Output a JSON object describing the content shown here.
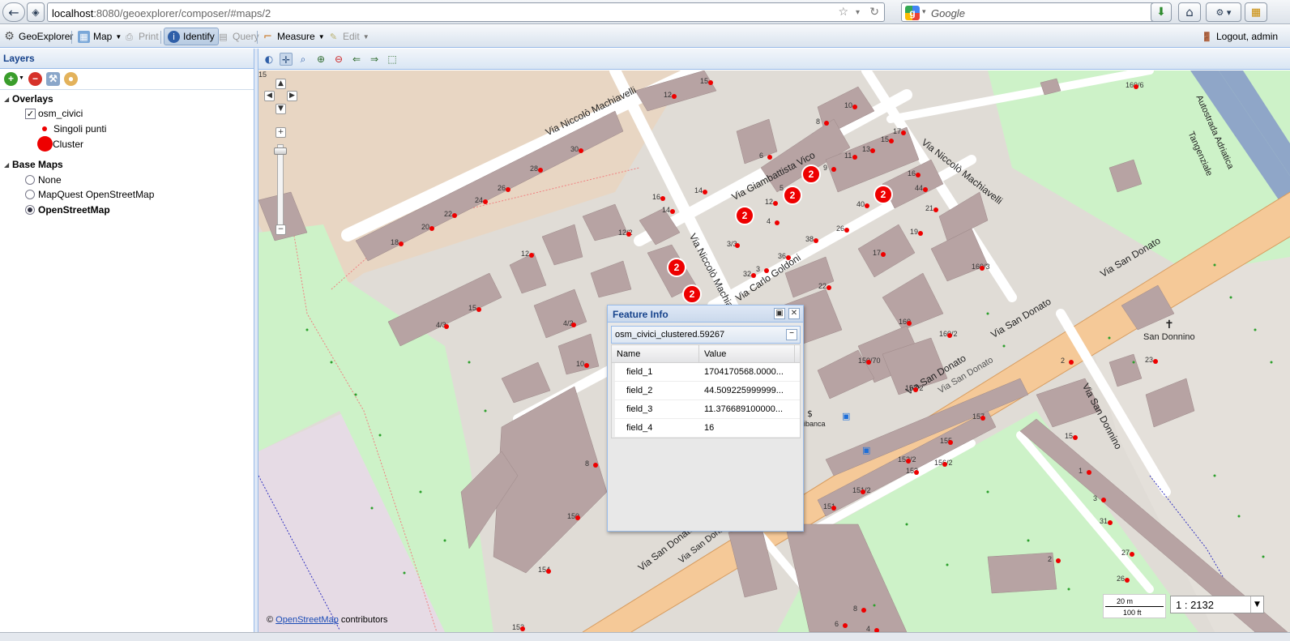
{
  "browser": {
    "url_host": "localhost",
    "url_path": ":8080/geoexplorer/composer/#maps/2",
    "search_placeholder": "Google"
  },
  "app_toolbar": {
    "brand": "GeoExplorer",
    "map": "Map",
    "print": "Print",
    "identify": "Identify",
    "query": "Query",
    "measure": "Measure",
    "edit": "Edit",
    "logout": "Logout, admin"
  },
  "layers_panel": {
    "title": "Layers",
    "overlays_label": "Overlays",
    "overlay_layer": "osm_civici",
    "legend_points": "Singoli punti",
    "legend_cluster": "Cluster",
    "basemaps_label": "Base Maps",
    "basemaps": [
      "None",
      "MapQuest OpenStreetMap",
      "OpenStreetMap"
    ],
    "selected_basemap": "OpenStreetMap"
  },
  "map": {
    "streets": [
      "Via Niccolò Machiavelli",
      "Via Giambattista Vico",
      "Via Niccolò Machiavelli",
      "Via Niccolò Machiave",
      "Via Carlo Goldoni",
      "Via San Donato",
      "Via San Donato",
      "Via San Donato",
      "Via San Donato",
      "Via San Donato",
      "Via San Donnino",
      "Autostrada Adriatica",
      "Tangenziale",
      "Via San Donato"
    ],
    "places": [
      "San Donnino",
      "nibanca"
    ],
    "numbers": [
      "15",
      "12",
      "10",
      "8",
      "6",
      "17",
      "11",
      "13",
      "15",
      "9",
      "5",
      "16",
      "44",
      "40",
      "21",
      "19",
      "17",
      "160/3",
      "160/6",
      "160",
      "160/2",
      "150/70",
      "157/2",
      "157",
      "155",
      "156/2",
      "153",
      "151/2",
      "151",
      "152/2",
      "30",
      "28",
      "26",
      "24",
      "22",
      "20",
      "18",
      "16",
      "14",
      "12/2",
      "12",
      "14",
      "3/3",
      "3",
      "4",
      "12",
      "26",
      "38",
      "36",
      "32",
      "22",
      "15",
      "4/3",
      "4/2",
      "10",
      "8",
      "150",
      "154",
      "152",
      "15",
      "1",
      "3",
      "31",
      "27",
      "26",
      "23",
      "2",
      "8",
      "6",
      "4",
      "2",
      "15"
    ],
    "cluster_count": "2",
    "attribution_prefix": "©",
    "attribution_link": "OpenStreetMap",
    "attribution_suffix": "contributors",
    "scale_m": "20 m",
    "scale_ft": "100 ft",
    "scale_ratio": "1 : 2132"
  },
  "feature_info": {
    "title": "Feature Info",
    "feature_id": "osm_civici_clustered.59267",
    "col_name": "Name",
    "col_value": "Value",
    "rows": [
      {
        "name": "field_1",
        "value": "1704170568.0000..."
      },
      {
        "name": "field_2",
        "value": "44.509225999999..."
      },
      {
        "name": "field_3",
        "value": "11.376689100000..."
      },
      {
        "name": "field_4",
        "value": "16"
      }
    ]
  },
  "colors": {
    "cluster": "#e00000",
    "building": "#b79f9f",
    "park": "#c8f0c8",
    "trunk_road": "#f8c890"
  }
}
